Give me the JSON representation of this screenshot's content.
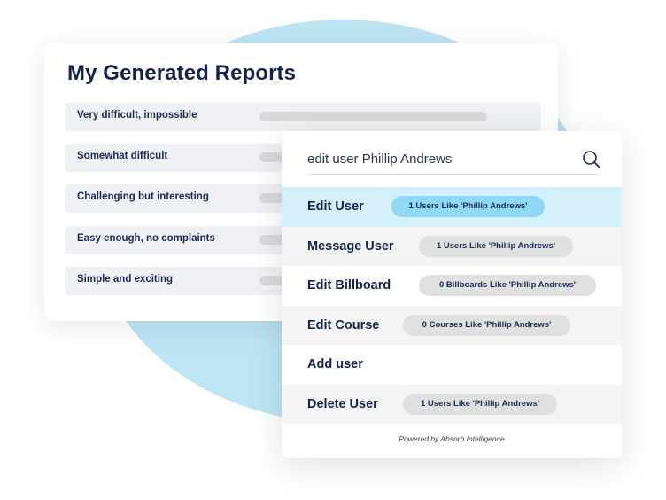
{
  "reports": {
    "title": "My Generated Reports",
    "rows": [
      {
        "label": "Very difficult, impossible"
      },
      {
        "label": "Somewhat difficult"
      },
      {
        "label": "Challenging but interesting"
      },
      {
        "label": "Easy enough, no complaints"
      },
      {
        "label": "Simple and exciting"
      }
    ]
  },
  "search": {
    "query": "edit user Phillip Andrews",
    "icon": "search-icon",
    "results": [
      {
        "action": "Edit User",
        "pill": "1 Users Like 'Phillip Andrews'",
        "active": true
      },
      {
        "action": "Message User",
        "pill": "1 Users Like 'Phillip Andrews'"
      },
      {
        "action": "Edit Billboard",
        "pill": "0 Billboards Like 'Phillip Andrews'"
      },
      {
        "action": "Edit Course",
        "pill": "0 Courses Like 'Phillip Andrews'"
      },
      {
        "action": "Add user",
        "pill": null
      },
      {
        "action": "Delete User",
        "pill": "1 Users Like 'Phillip Andrews'"
      }
    ],
    "footer": "Powered by Absorb Intelligence"
  },
  "colors": {
    "accent_blob": "#bde5f4",
    "active_row": "#d3f0fb",
    "active_pill": "#8fd8f6",
    "title_navy": "#13214d"
  }
}
